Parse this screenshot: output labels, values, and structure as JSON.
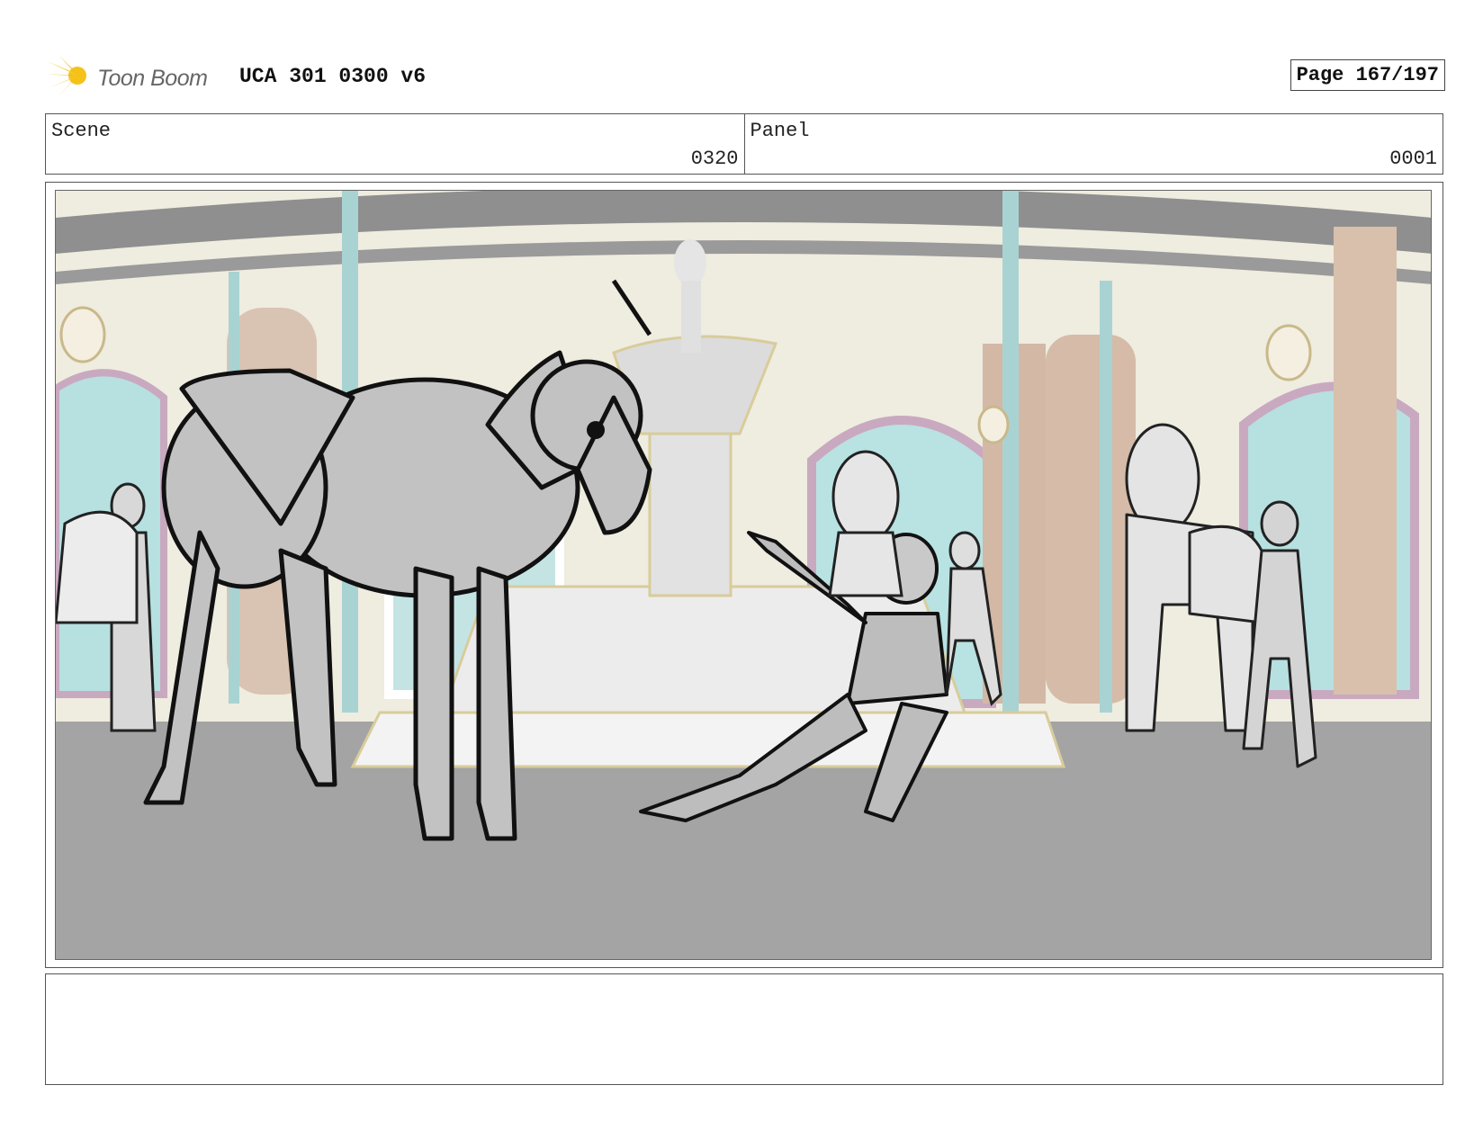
{
  "header": {
    "logo_text": "Toon Boom",
    "doc_title": "UCA 301 0300 v6",
    "page_label": "Page 167/197"
  },
  "info": {
    "scene_label": "Scene",
    "scene_value": "0320",
    "panel_label": "Panel",
    "panel_value": "0001"
  },
  "frame": {
    "description_icon": "storyboard-drawing"
  },
  "notes": {
    "text": ""
  },
  "colors": {
    "logo_yellow": "#f5c21a",
    "border": "#555555",
    "floor": "#a4a4a4",
    "wall": "#efece0",
    "pillar": "#a9d3d3"
  }
}
